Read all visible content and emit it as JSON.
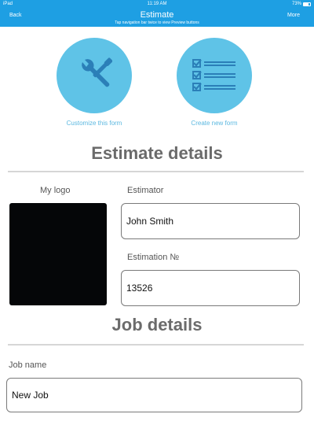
{
  "status_bar": {
    "device": "iPad",
    "time": "11:19 AM",
    "battery": "73%"
  },
  "nav": {
    "back_label": "Back",
    "title": "Estimate",
    "subtitle": "Tap navigation bar twice to view Preview buttons",
    "more_label": "More"
  },
  "actions": {
    "customize_label": "Customize this form",
    "create_label": "Create new form"
  },
  "estimate_section": {
    "title": "Estimate details",
    "logo_label": "My logo",
    "estimator_label": "Estimator",
    "estimator_value": "John Smith",
    "estimation_no_label": "Estimation №",
    "estimation_no_value": "13526"
  },
  "job_section": {
    "title": "Job details",
    "job_name_label": "Job name",
    "job_name_value": "New Job"
  },
  "colors": {
    "accent": "#1e9fe3",
    "circle": "#5fc3e7",
    "icon": "#2b7fb8",
    "section_title": "#6b6b6b"
  }
}
